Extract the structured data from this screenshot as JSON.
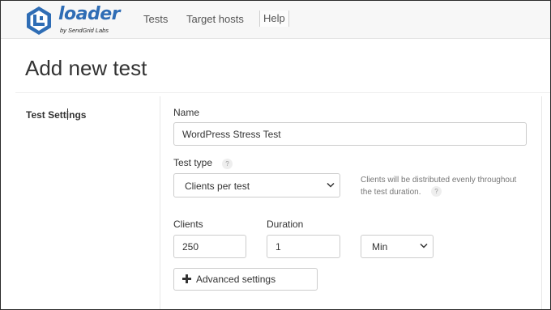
{
  "brand": {
    "name": "loader",
    "subtitle": "by SendGrid Labs",
    "color": "#2f6db5"
  },
  "nav": {
    "items": [
      {
        "label": "Tests"
      },
      {
        "label": "Target hosts"
      },
      {
        "label": "Help"
      }
    ]
  },
  "page": {
    "title": "Add new test"
  },
  "section": {
    "label": "Test Settings"
  },
  "form": {
    "name": {
      "label": "Name",
      "value": "WordPress Stress Test"
    },
    "test_type": {
      "label": "Test type",
      "help_icon": "?",
      "selected": "Clients per test",
      "hint": "Clients will be distributed evenly throughout the test duration.",
      "hint_help_icon": "?"
    },
    "clients": {
      "label": "Clients",
      "value": "250"
    },
    "duration": {
      "label": "Duration",
      "value": "1",
      "unit_selected": "Min"
    },
    "advanced": {
      "icon": "plus-icon",
      "label": "Advanced settings"
    }
  }
}
